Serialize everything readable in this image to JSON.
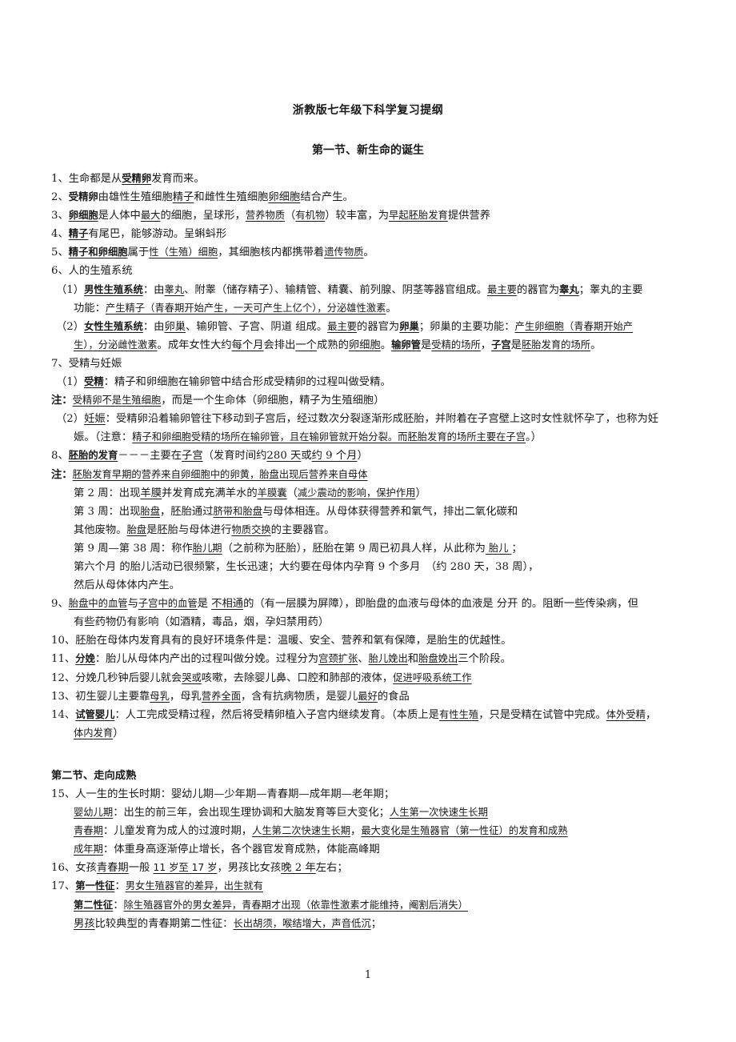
{
  "document": {
    "title": "浙教版七年级下科学复习提纲",
    "section1_heading": "第一节、新生命的诞生",
    "section2_heading": "第二节、走向成熟",
    "page_number": "1"
  },
  "lines": [
    {
      "indent": 0,
      "segs": [
        {
          "t": "1、生命都是从"
        },
        {
          "t": "受精卵",
          "b": 1,
          "u": 1,
          "k": 1
        },
        {
          "t": "发育而来。"
        }
      ]
    },
    {
      "indent": 0,
      "segs": [
        {
          "t": "2、"
        },
        {
          "t": "受精卵",
          "b": 1,
          "k": 1
        },
        {
          "t": "由雄性生殖细胞"
        },
        {
          "t": "精子",
          "u": 1
        },
        {
          "t": "和雌性生殖细胞"
        },
        {
          "t": "卵细胞",
          "u": 1
        },
        {
          "t": "结合产生。"
        }
      ]
    },
    {
      "indent": 0,
      "segs": [
        {
          "t": "3、"
        },
        {
          "t": "卵细胞",
          "b": 1,
          "u": 1,
          "k": 1
        },
        {
          "t": "是人体中"
        },
        {
          "t": "最大",
          "u": 1,
          "k": 1
        },
        {
          "t": "的细胞，呈球形，"
        },
        {
          "t": "营养物质",
          "u": 1,
          "k": 1
        },
        {
          "t": "（"
        },
        {
          "t": "有机物",
          "u": 1,
          "k": 1
        },
        {
          "t": "）较丰富，为"
        },
        {
          "t": "早起胚胎发育",
          "u": 1,
          "k": 1
        },
        {
          "t": "提供营养"
        }
      ]
    },
    {
      "indent": 0,
      "segs": [
        {
          "t": "4、"
        },
        {
          "t": "精子",
          "b": 1,
          "u": 1,
          "k": 1
        },
        {
          "t": "有尾巴，能够游动。呈蝌蚪形"
        }
      ]
    },
    {
      "indent": 0,
      "segs": [
        {
          "t": "5、"
        },
        {
          "t": "精子和卵细胞",
          "b": 1,
          "u": 1,
          "k": 1
        },
        {
          "t": "属于"
        },
        {
          "t": "性（生殖）细胞",
          "u": 1,
          "k": 1
        },
        {
          "t": "，其细胞核内都携带着"
        },
        {
          "t": "遗传物质",
          "u": 1,
          "k": 1
        },
        {
          "t": "。"
        }
      ]
    },
    {
      "indent": 0,
      "segs": [
        {
          "t": "6、人的生殖系统"
        }
      ]
    },
    {
      "indent": 1,
      "segs": [
        {
          "t": "（1）"
        },
        {
          "t": "男性生殖系统",
          "b": 1,
          "u": 1,
          "k": 1
        },
        {
          "t": "：由"
        },
        {
          "t": "睾丸",
          "u": 1,
          "k": 1
        },
        {
          "t": "、附睾（储存精子）、输精管、精囊、前列腺、阴茎等器官组成。"
        },
        {
          "t": "最主要",
          "u": 1,
          "k": 1
        },
        {
          "t": "的器官为"
        },
        {
          "t": "睾丸",
          "b": 1,
          "u": 1,
          "k": 1
        },
        {
          "t": "；睾丸的主要"
        }
      ]
    },
    {
      "indent": 2,
      "segs": [
        {
          "t": "功能："
        },
        {
          "t": "产生精子（青春期开始产生，一天可产生上亿个），分泌雄性激素",
          "u": 1,
          "k": 1
        },
        {
          "t": "。"
        }
      ]
    },
    {
      "indent": 1,
      "segs": [
        {
          "t": "（2）"
        },
        {
          "t": "女性生殖系统",
          "b": 1,
          "u": 1,
          "k": 1
        },
        {
          "t": "：由"
        },
        {
          "t": "卵巢",
          "u": 1
        },
        {
          "t": "、输卵管、子宫、阴道 组成。"
        },
        {
          "t": "最主要",
          "u": 1,
          "k": 1
        },
        {
          "t": "的器官为"
        },
        {
          "t": "卵巢",
          "b": 1,
          "u": 1,
          "k": 1
        },
        {
          "t": "；卵巢的主要功能："
        },
        {
          "t": "产生卵细胞（青春期开始产",
          "u": 1,
          "k": 1
        }
      ]
    },
    {
      "indent": 2,
      "segs": [
        {
          "t": "生），分泌雌性激素",
          "u": 1,
          "k": 1
        },
        {
          "t": "。成年女性大约"
        },
        {
          "t": "每个月",
          "u": 1
        },
        {
          "t": "会排出"
        },
        {
          "t": "一个",
          "u": 1
        },
        {
          "t": "成熟的"
        },
        {
          "t": "卵细胞",
          "u": 1
        },
        {
          "t": "。"
        },
        {
          "t": "输卵管",
          "b": 1,
          "u": 1,
          "k": 1
        },
        {
          "t": "是"
        },
        {
          "t": "受精的场所",
          "u": 1,
          "k": 1
        },
        {
          "t": "，"
        },
        {
          "t": "子宫",
          "b": 1,
          "u": 1,
          "k": 1
        },
        {
          "t": "是"
        },
        {
          "t": "胚胎发育的场所",
          "u": 1,
          "k": 1
        },
        {
          "t": "。"
        }
      ]
    },
    {
      "indent": 0,
      "segs": [
        {
          "t": "7、受精与妊娠"
        }
      ]
    },
    {
      "indent": 1,
      "segs": [
        {
          "t": "（1）"
        },
        {
          "t": "受精",
          "b": 1,
          "u": 1,
          "k": 1
        },
        {
          "t": "：精子和卵细胞在输卵管中结合形成受精卵的过程叫做受精。"
        }
      ]
    },
    {
      "indent": 0,
      "segs": [
        {
          "t": "注：",
          "b": 1
        },
        {
          "t": "受精卵不是生殖细胞",
          "u": 1,
          "k": 1
        },
        {
          "t": "，而是一个生命体（卵细胞，精子为生殖细胞）"
        }
      ]
    },
    {
      "indent": 1,
      "segs": [
        {
          "t": "（2）"
        },
        {
          "t": "妊娠",
          "u": 1
        },
        {
          "t": "：受精卵沿着输卵管往下移动到子宫后，经过数次分裂逐渐形成胚胎，并附着在子宫壁上这时女性就怀孕了，也称为妊"
        }
      ]
    },
    {
      "indent": 2,
      "segs": [
        {
          "t": "娠。（注意："
        },
        {
          "t": "精子和卵细胞受精的场所在输卵管，且在输卵管就开始分裂。而胚胎发育的场所主要在子宫",
          "u": 1,
          "k": 1
        },
        {
          "t": "。）"
        }
      ]
    },
    {
      "indent": 0,
      "segs": [
        {
          "t": "8、"
        },
        {
          "t": "胚胎的发育",
          "b": 1,
          "u": 1,
          "k": 1
        },
        {
          "t": "－－－主要在"
        },
        {
          "t": "子宫",
          "u": 1
        },
        {
          "t": "（发育时间约"
        },
        {
          "t": "280 天",
          "u": 1
        },
        {
          "t": "或"
        },
        {
          "t": "约 9 个月",
          "u": 1
        },
        {
          "t": "）"
        }
      ]
    },
    {
      "indent": 0,
      "segs": [
        {
          "t": "注：",
          "b": 1
        },
        {
          "t": "胚胎发育早期的营养来自卵细胞中的卵黄，胎盘出现后营养来自母体",
          "u": 1,
          "k": 1
        }
      ]
    },
    {
      "indent": 2,
      "segs": [
        {
          "t": "第 2 周：出现"
        },
        {
          "t": "羊膜",
          "u": 1
        },
        {
          "t": "并发育成充满羊水的"
        },
        {
          "t": "羊膜囊",
          "u": 1,
          "k": 1
        },
        {
          "t": "（"
        },
        {
          "t": "减少震动的影响，保护作用",
          "u": 1,
          "k": 1
        },
        {
          "t": "）"
        }
      ]
    },
    {
      "indent": 2,
      "segs": [
        {
          "t": "第 3 周：出现"
        },
        {
          "t": "胎盘",
          "u": 1,
          "k": 1
        },
        {
          "t": "，胚胎通过"
        },
        {
          "t": "脐带和胎盘",
          "u": 1,
          "k": 1
        },
        {
          "t": "与母体相连。从母体获得营养和氧气，排出二氧化碳和"
        }
      ]
    },
    {
      "indent": 2,
      "segs": [
        {
          "t": "其他废物。"
        },
        {
          "t": "胎盘",
          "u": 1,
          "k": 1
        },
        {
          "t": "是胚胎与母体进行"
        },
        {
          "t": "物质交换",
          "u": 1,
          "k": 1
        },
        {
          "t": "的主要器官。"
        }
      ]
    },
    {
      "indent": 2,
      "segs": [
        {
          "t": "第 9 周—第 38 周：称作"
        },
        {
          "t": "胎儿期",
          "u": 1,
          "k": 1
        },
        {
          "t": "（之前称为胚胎），胚胎在第 9 周已初具人样，从此称为"
        },
        {
          "t": " 胎儿 ",
          "u": 1,
          "k": 1
        },
        {
          "t": " ；"
        }
      ]
    },
    {
      "indent": 2,
      "segs": [
        {
          "t": "第六个月 的胎儿活动已很频繁，生长迅速；大约要在母体内孕育 9 个多月　（约 280 天，38 周），"
        }
      ]
    },
    {
      "indent": 2,
      "segs": [
        {
          "t": "然后从母体体内产生。"
        }
      ]
    },
    {
      "indent": 0,
      "segs": [
        {
          "t": "9、"
        },
        {
          "t": "胎盘中的血管",
          "u": 1,
          "k": 1
        },
        {
          "t": "与"
        },
        {
          "t": "子宫中的血管",
          "u": 1,
          "k": 1
        },
        {
          "t": "是 "
        },
        {
          "t": "不相通",
          "u": 1
        },
        {
          "t": "的（有一层膜为屏障），即胎盘的血液与母体的血液是 分开 的。阻断一些传染病，但"
        }
      ]
    },
    {
      "indent": 2,
      "segs": [
        {
          "t": "有些药物仍有影响（如酒精，毒品，烟，孕妇禁用药）"
        }
      ]
    },
    {
      "indent": 0,
      "segs": [
        {
          "t": "10、胚胎在母体内发育具有的良好环境条件是：温暖、安全、营养和氧有保障，是胎生的优越性。"
        }
      ]
    },
    {
      "indent": 0,
      "segs": [
        {
          "t": "11、"
        },
        {
          "t": "分娩",
          "b": 1,
          "u": 1,
          "k": 1
        },
        {
          "t": "：胎儿从母体内产出的过程叫做分娩。过程分为"
        },
        {
          "t": "宫颈扩张",
          "u": 1,
          "k": 1
        },
        {
          "t": "、"
        },
        {
          "t": "胎儿娩出",
          "u": 1,
          "k": 1
        },
        {
          "t": "和"
        },
        {
          "t": "胎盘娩出",
          "u": 1,
          "k": 1
        },
        {
          "t": "三个阶段。"
        }
      ]
    },
    {
      "indent": 0,
      "segs": [
        {
          "t": "12、分娩几秒钟后婴儿就会"
        },
        {
          "t": "哭或",
          "u": 1,
          "k": 1
        },
        {
          "t": "咳嗽，去除婴儿鼻、口腔和肺部的液体，"
        },
        {
          "t": "促进呼吸系统工作",
          "u": 1,
          "k": 1
        }
      ]
    },
    {
      "indent": 0,
      "segs": [
        {
          "t": "13、初生婴儿主要靠"
        },
        {
          "t": "母乳",
          "u": 1,
          "k": 1
        },
        {
          "t": "，母乳"
        },
        {
          "t": "营养全面",
          "u": 1,
          "k": 1
        },
        {
          "t": "，含有抗病物质，是婴儿"
        },
        {
          "t": "最好",
          "u": 1,
          "k": 1
        },
        {
          "t": "的食品"
        }
      ]
    },
    {
      "indent": 0,
      "segs": [
        {
          "t": "14、"
        },
        {
          "t": "试管婴儿",
          "b": 1,
          "u": 1,
          "k": 1
        },
        {
          "t": "：人工完成受精过程，然后将受精卵植入子宫内继续发育。（本质上是"
        },
        {
          "t": "有性生殖",
          "u": 1,
          "k": 1
        },
        {
          "t": "，只是受精在试管中完成。"
        },
        {
          "t": "体外受精",
          "u": 1,
          "k": 1
        },
        {
          "t": "，"
        }
      ]
    },
    {
      "indent": 2,
      "segs": [
        {
          "t": "体内发育",
          "u": 1,
          "k": 1
        },
        {
          "t": "）"
        }
      ]
    },
    {
      "gap": 1
    },
    {
      "heading": 1
    },
    {
      "indent": 0,
      "segs": [
        {
          "t": "15、人一生的生长时期：婴幼儿期—少年期—青春期—成年期—老年期；"
        }
      ]
    },
    {
      "indent": 2,
      "segs": [
        {
          "t": "婴幼儿期",
          "u": 1,
          "k": 1
        },
        {
          "t": "：出生的前三年，会出现生理协调和大脑发育等巨大变化；"
        },
        {
          "t": "人生第一次快速生长期",
          "u": 1,
          "k": 1
        }
      ]
    },
    {
      "indent": 2,
      "segs": [
        {
          "t": "青春期",
          "u": 1,
          "k": 1
        },
        {
          "t": "：儿童发育为成人的过渡时期，"
        },
        {
          "t": "人生第二次快速生长期",
          "u": 1,
          "k": 1
        },
        {
          "t": "，"
        },
        {
          "t": "最大变化是生殖器官（第一性征）的发育和成熟",
          "u": 1,
          "k": 1
        }
      ]
    },
    {
      "indent": 2,
      "segs": [
        {
          "t": "成年期",
          "u": 1,
          "k": 1
        },
        {
          "t": "：体重身高逐渐停止增长，各个器官发育成熟，体能高峰期"
        }
      ]
    },
    {
      "indent": 0,
      "segs": [
        {
          "t": "16、女孩"
        },
        {
          "t": "青春期",
          "u": 1
        },
        {
          "t": "一般 "
        },
        {
          "t": "11 岁至 17 岁",
          "u": 1,
          "k": 1
        },
        {
          "t": "，男孩比女孩"
        },
        {
          "t": "晚 2 年",
          "u": 1
        },
        {
          "t": "左右；"
        }
      ]
    },
    {
      "indent": 0,
      "segs": [
        {
          "t": "17、"
        },
        {
          "t": "第一性征",
          "b": 1,
          "u": 1,
          "k": 1
        },
        {
          "t": "："
        },
        {
          "t": "男女生殖器官的差异，出生就有",
          "u": 1,
          "k": 1
        }
      ]
    },
    {
      "indent": 2,
      "segs": [
        {
          "t": "第二性征",
          "b": 1,
          "u": 1,
          "k": 1
        },
        {
          "t": "："
        },
        {
          "t": "除生殖器官外的男女差异，青春期才出现（依靠性激素才能维持，阉割后消失）",
          "u": 1,
          "k": 1
        }
      ]
    },
    {
      "indent": 2,
      "segs": [
        {
          "t": "男孩",
          "u": 1
        },
        {
          "t": "比较典型的青春期第二性征："
        },
        {
          "t": "长出胡须，喉结增大，声音低沉",
          "u": 1,
          "k": 1
        },
        {
          "t": "；"
        }
      ]
    }
  ]
}
